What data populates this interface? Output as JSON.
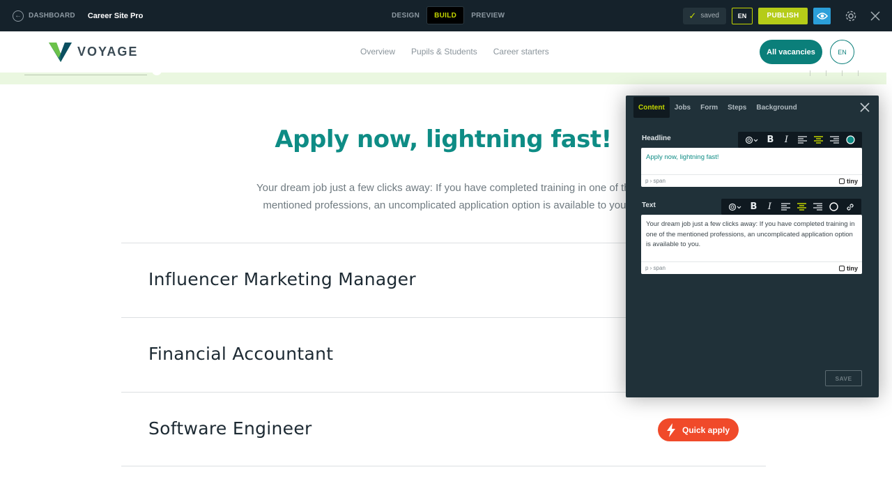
{
  "topbar": {
    "back_label": "DASHBOARD",
    "site_name": "Career Site Pro",
    "modes": [
      {
        "label": "DESIGN",
        "active": false
      },
      {
        "label": "BUILD",
        "active": true
      },
      {
        "label": "PREVIEW",
        "active": false
      }
    ],
    "saved_label": "saved",
    "language": "EN",
    "publish_label": "PUBLISH",
    "colors": {
      "accent": "#c4d600",
      "publish": "#b5cc18",
      "preview_eye": "#2b9fd9",
      "bar_bg": "#15222b"
    }
  },
  "site": {
    "logo_text": "VOYAGE",
    "nav": [
      "Overview",
      "Pupils & Students",
      "Career starters"
    ],
    "vacancies_button": "All vacancies",
    "language": "EN",
    "colors": {
      "brand": "#0b7f7a",
      "headline": "#0e8c85",
      "quick_apply": "#f04a2a"
    }
  },
  "main": {
    "headline": "Apply now, lightning fast!",
    "intro_line1": "Your dream job just a few clicks away: If you have completed training in one of the",
    "intro_line2": "mentioned professions, an uncomplicated application option is available to you.",
    "jobs": [
      {
        "title": "Influencer Marketing Manager"
      },
      {
        "title": "Financial Accountant"
      },
      {
        "title": "Software Engineer",
        "action": "Quick apply"
      }
    ]
  },
  "editor": {
    "tabs": [
      {
        "label": "Content",
        "active": true
      },
      {
        "label": "Jobs",
        "active": false
      },
      {
        "label": "Form",
        "active": false
      },
      {
        "label": "Steps",
        "active": false
      },
      {
        "label": "Background",
        "active": false
      }
    ],
    "headline_field": {
      "label": "Headline",
      "value": "Apply now, lightning fast!",
      "path": "p › span",
      "brand": "tiny"
    },
    "text_field": {
      "label": "Text",
      "value": "Your dream job just a few clicks away: If you have completed training in one of the mentioned professions, an uncomplicated application option is available to you.",
      "path": "p › span",
      "brand": "tiny"
    },
    "save_label": "SAVE"
  }
}
